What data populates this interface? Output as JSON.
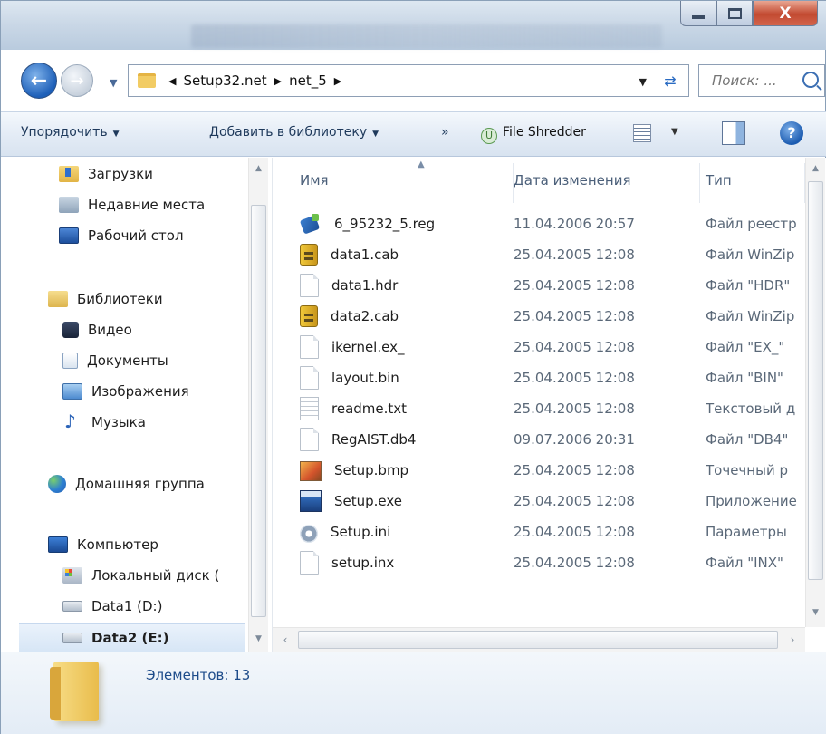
{
  "window": {
    "close_label": "X"
  },
  "address": {
    "crumbs": [
      "Setup32.net",
      "net_5"
    ],
    "search_placeholder": "Поиск: ..."
  },
  "toolbar": {
    "organize": "Упорядочить",
    "add_to_library": "Добавить в библиотеку",
    "more": "»",
    "shredder": "File Shredder",
    "help": "?"
  },
  "nav": {
    "items": [
      {
        "label": "Загрузки",
        "icon": "downloads-icon"
      },
      {
        "label": "Недавние места",
        "icon": "recent-places-icon"
      },
      {
        "label": "Рабочий стол",
        "icon": "desktop-icon"
      },
      {
        "label": "Библиотеки",
        "icon": "libraries-icon"
      },
      {
        "label": "Видео",
        "icon": "video-icon"
      },
      {
        "label": "Документы",
        "icon": "documents-icon"
      },
      {
        "label": "Изображения",
        "icon": "pictures-icon"
      },
      {
        "label": "Музыка",
        "icon": "music-icon"
      },
      {
        "label": "Домашняя группа",
        "icon": "homegroup-icon"
      },
      {
        "label": "Компьютер",
        "icon": "computer-icon"
      },
      {
        "label": "Локальный диск (",
        "icon": "local-disk-icon"
      },
      {
        "label": "Data1 (D:)",
        "icon": "drive-icon"
      },
      {
        "label": "Data2 (E:)",
        "icon": "drive-icon",
        "selected": true
      }
    ]
  },
  "files": {
    "columns": {
      "name": "Имя",
      "date": "Дата изменения",
      "type": "Тип"
    },
    "rows": [
      {
        "name": "6_95232_5.reg",
        "date": "11.04.2006 20:57",
        "type": "Файл реестр",
        "icon": "reg-file-icon"
      },
      {
        "name": "data1.cab",
        "date": "25.04.2005 12:08",
        "type": "Файл WinZip",
        "icon": "cab-file-icon"
      },
      {
        "name": "data1.hdr",
        "date": "25.04.2005 12:08",
        "type": "Файл \"HDR\"",
        "icon": "blank-file-icon"
      },
      {
        "name": "data2.cab",
        "date": "25.04.2005 12:08",
        "type": "Файл WinZip",
        "icon": "cab-file-icon"
      },
      {
        "name": "ikernel.ex_",
        "date": "25.04.2005 12:08",
        "type": "Файл \"EX_\"",
        "icon": "blank-file-icon"
      },
      {
        "name": "layout.bin",
        "date": "25.04.2005 12:08",
        "type": "Файл \"BIN\"",
        "icon": "blank-file-icon"
      },
      {
        "name": "readme.txt",
        "date": "25.04.2005 12:08",
        "type": "Текстовый д",
        "icon": "text-file-icon"
      },
      {
        "name": "RegAIST.db4",
        "date": "09.07.2006 20:31",
        "type": "Файл \"DB4\"",
        "icon": "blank-file-icon"
      },
      {
        "name": "Setup.bmp",
        "date": "25.04.2005 12:08",
        "type": "Точечный р",
        "icon": "bitmap-file-icon"
      },
      {
        "name": "Setup.exe",
        "date": "25.04.2005 12:08",
        "type": "Приложение",
        "icon": "exe-file-icon"
      },
      {
        "name": "Setup.ini",
        "date": "25.04.2005 12:08",
        "type": "Параметры",
        "icon": "ini-file-icon"
      },
      {
        "name": "setup.inx",
        "date": "25.04.2005 12:08",
        "type": "Файл \"INX\"",
        "icon": "blank-file-icon"
      }
    ]
  },
  "details": {
    "status": "Элементов: 13"
  }
}
